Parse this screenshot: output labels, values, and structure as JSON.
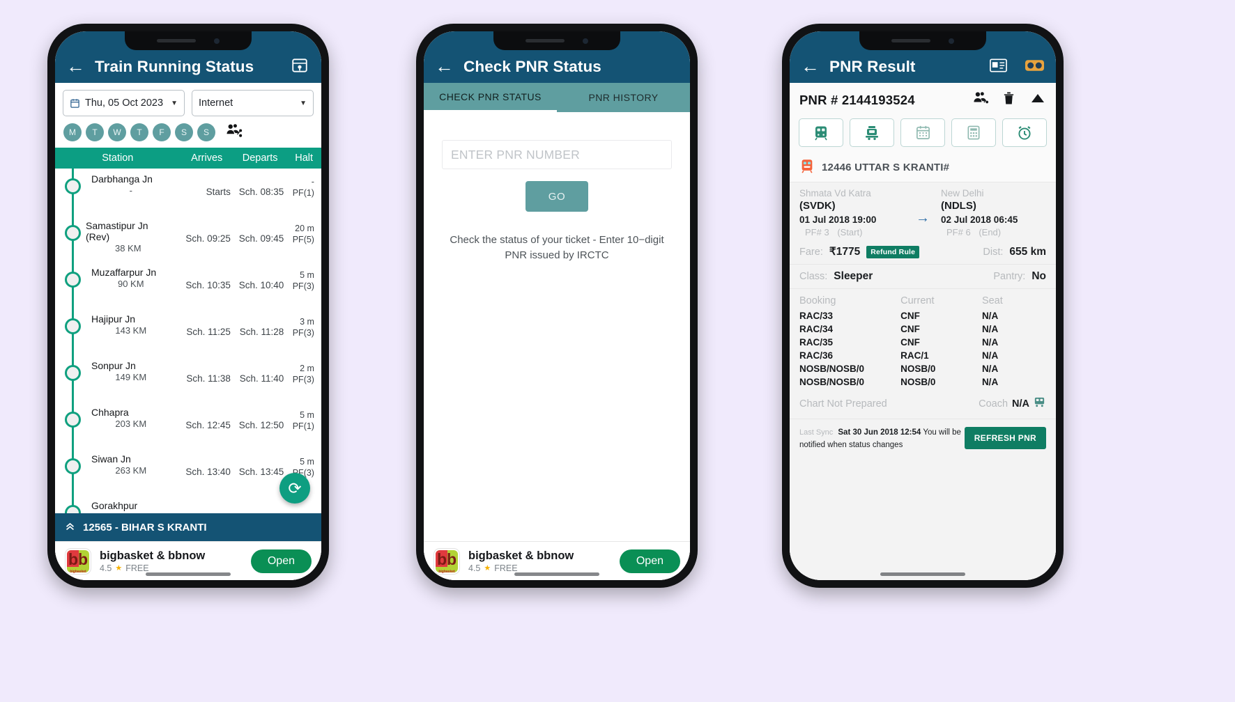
{
  "colors": {
    "page_bg": "#f0eafc",
    "appbar": "#145374",
    "teal_header": "#0c9e83",
    "tab_bar": "#5f9ea0",
    "accent_green": "#0fa07f",
    "refund_tag": "#0f7d63",
    "ad_open": "#0a8f55"
  },
  "phone1": {
    "appbar": {
      "back_icon": "back-arrow-icon",
      "title": "Train Running Status",
      "map_icon": "map-location-icon"
    },
    "filters": {
      "date": {
        "icon": "calendar-icon",
        "value": "Thu, 05 Oct 2023",
        "caret": "▼"
      },
      "source": {
        "value": "Internet",
        "caret": "▼"
      }
    },
    "days": [
      "M",
      "T",
      "W",
      "T",
      "F",
      "S",
      "S"
    ],
    "share_icon": "share-people-icon",
    "table_headers": {
      "station": "Station",
      "arrives": "Arrives",
      "departs": "Departs",
      "halt": "Halt"
    },
    "rows": [
      {
        "station": "Darbhanga Jn",
        "dist": "-",
        "arrives": "Starts",
        "departs": "Sch. 08:35",
        "halt": "-",
        "pf": "PF(1)"
      },
      {
        "station": "Samastipur Jn",
        "station2": "(Rev)",
        "dist": "38 KM",
        "arrives": "Sch. 09:25",
        "departs": "Sch. 09:45",
        "halt": "20 m",
        "pf": "PF(5)"
      },
      {
        "station": "Muzaffarpur Jn",
        "dist": "90 KM",
        "arrives": "Sch. 10:35",
        "departs": "Sch. 10:40",
        "halt": "5 m",
        "pf": "PF(3)"
      },
      {
        "station": "Hajipur Jn",
        "dist": "143 KM",
        "arrives": "Sch. 11:25",
        "departs": "Sch. 11:28",
        "halt": "3 m",
        "pf": "PF(3)"
      },
      {
        "station": "Sonpur Jn",
        "dist": "149 KM",
        "arrives": "Sch. 11:38",
        "departs": "Sch. 11:40",
        "halt": "2 m",
        "pf": "PF(3)"
      },
      {
        "station": "Chhapra",
        "dist": "203 KM",
        "arrives": "Sch. 12:45",
        "departs": "Sch. 12:50",
        "halt": "5 m",
        "pf": "PF(1)"
      },
      {
        "station": "Siwan Jn",
        "dist": "263 KM",
        "arrives": "Sch. 13:40",
        "departs": "Sch. 13:45",
        "halt": "5 m",
        "pf": "PF(3)"
      },
      {
        "station": "Gorakhpur",
        "dist": "",
        "arrives": "",
        "departs": "",
        "halt": "",
        "pf": ""
      }
    ],
    "refresh_icon": "refresh-icon",
    "trainbar": {
      "chevron_icon": "chevron-up-double-icon",
      "label": "12565 - BIHAR S KRANTI"
    }
  },
  "phone2": {
    "appbar": {
      "back_icon": "back-arrow-icon",
      "title": "Check PNR Status"
    },
    "tabs": [
      {
        "label": "CHECK PNR STATUS",
        "active": true
      },
      {
        "label": "PNR HISTORY",
        "active": false
      }
    ],
    "input": {
      "placeholder": "ENTER PNR NUMBER",
      "value": ""
    },
    "go_button": "GO",
    "hint": "Check the status of your ticket - Enter 10−digit PNR issued by IRCTC"
  },
  "phone3": {
    "appbar": {
      "back_icon": "back-arrow-icon",
      "title": "PNR Result",
      "icons": [
        "ticket-card-icon",
        "binoculars-icon"
      ]
    },
    "pnr_label": "PNR # 2144193524",
    "head_icons": [
      "add-passenger-icon",
      "delete-icon",
      "collapse-up-icon"
    ],
    "quick_buttons": [
      "train-coach-icon",
      "train-engine-icon",
      "calendar-icon",
      "calculator-icon",
      "alarm-clock-icon"
    ],
    "train": {
      "icon": "train-front-icon",
      "name": "12446 UTTAR S KRANTI#"
    },
    "origin": {
      "city": "Shmata Vd Katra",
      "code": "(SVDK)",
      "datetime": "01 Jul 2018 19:00",
      "pf": "PF# 3",
      "tag": "(Start)"
    },
    "destination": {
      "city": "New Delhi",
      "code": "(NDLS)",
      "datetime": "02 Jul 2018 06:45",
      "pf": "PF# 6",
      "tag": "(End)"
    },
    "arrow": "→",
    "fare": {
      "label": "Fare:",
      "value": "₹1775",
      "tag": "Refund Rule"
    },
    "dist": {
      "label": "Dist:",
      "value": "655 km"
    },
    "class": {
      "label": "Class:",
      "value": "Sleeper"
    },
    "pantry": {
      "label": "Pantry:",
      "value": "No"
    },
    "pax_headers": {
      "booking": "Booking",
      "current": "Current",
      "seat": "Seat"
    },
    "passengers": [
      {
        "booking": "RAC/33",
        "current": "CNF",
        "seat": "N/A"
      },
      {
        "booking": "RAC/34",
        "current": "CNF",
        "seat": "N/A"
      },
      {
        "booking": "RAC/35",
        "current": "CNF",
        "seat": "N/A"
      },
      {
        "booking": "RAC/36",
        "current": "RAC/1",
        "seat": "N/A"
      },
      {
        "booking": "NOSB/NOSB/0",
        "current": "NOSB/0",
        "seat": "N/A"
      },
      {
        "booking": "NOSB/NOSB/0",
        "current": "NOSB/0",
        "seat": "N/A"
      }
    ],
    "chart_status": "Chart Not Prepared",
    "coach": {
      "label": "Coach",
      "value": "N/A",
      "icon": "coach-position-icon"
    },
    "sync": {
      "label": "Last Sync",
      "time": "Sat 30 Jun 2018 12:54",
      "note": "You will be notified when status changes"
    },
    "refresh_button": "REFRESH PNR"
  },
  "ad": {
    "logo_text": "bb",
    "logo_caption": "bigbasket",
    "title": "bigbasket & bbnow",
    "rating": "4.5",
    "star": "★",
    "price": "FREE",
    "button": "Open"
  }
}
